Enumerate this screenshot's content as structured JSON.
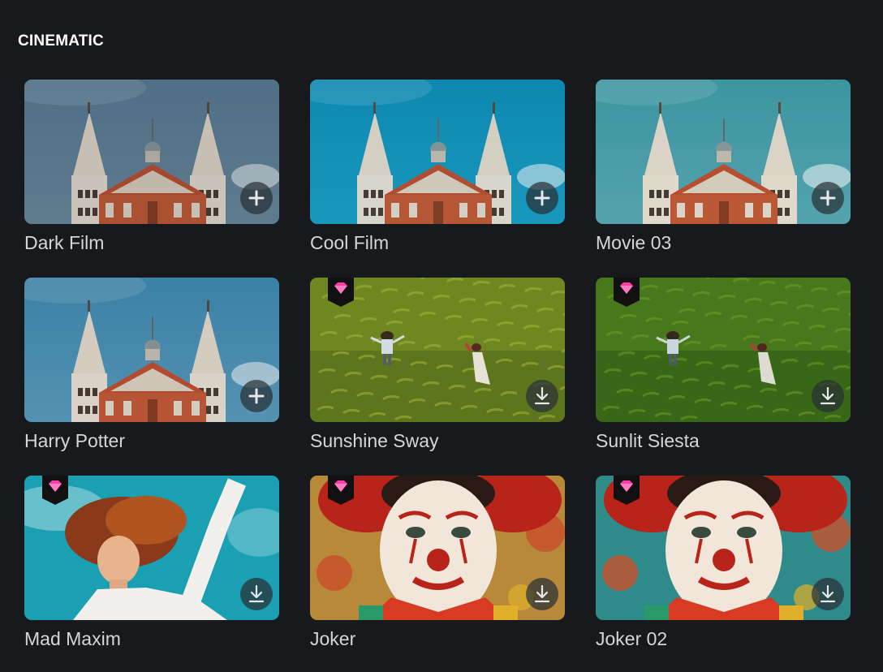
{
  "section": {
    "title": "CINEMATIC"
  },
  "presets": [
    {
      "label": "Dark Film",
      "scene": "church",
      "tint": "dark",
      "premium": false,
      "action": "plus-icon"
    },
    {
      "label": "Cool Film",
      "scene": "church",
      "tint": "cool",
      "premium": false,
      "action": "plus-icon"
    },
    {
      "label": "Movie 03",
      "scene": "church",
      "tint": "teal",
      "premium": false,
      "action": "plus-icon"
    },
    {
      "label": "Harry Potter",
      "scene": "church",
      "tint": "steel",
      "premium": false,
      "action": "plus-icon"
    },
    {
      "label": "Sunshine Sway",
      "scene": "field",
      "tint": "warm",
      "premium": true,
      "action": "download-icon"
    },
    {
      "label": "Sunlit Siesta",
      "scene": "field",
      "tint": "green",
      "premium": true,
      "action": "download-icon"
    },
    {
      "label": "Mad Maxim",
      "scene": "woman",
      "tint": "aqua",
      "premium": true,
      "action": "download-icon"
    },
    {
      "label": "Joker",
      "scene": "clown",
      "tint": "warm",
      "premium": true,
      "action": "download-icon"
    },
    {
      "label": "Joker 02",
      "scene": "clown",
      "tint": "cool",
      "premium": true,
      "action": "download-icon"
    }
  ],
  "colors": {
    "background": "#17191c",
    "premium_badge": "#ff3ea5",
    "label": "#d4d6d9"
  }
}
